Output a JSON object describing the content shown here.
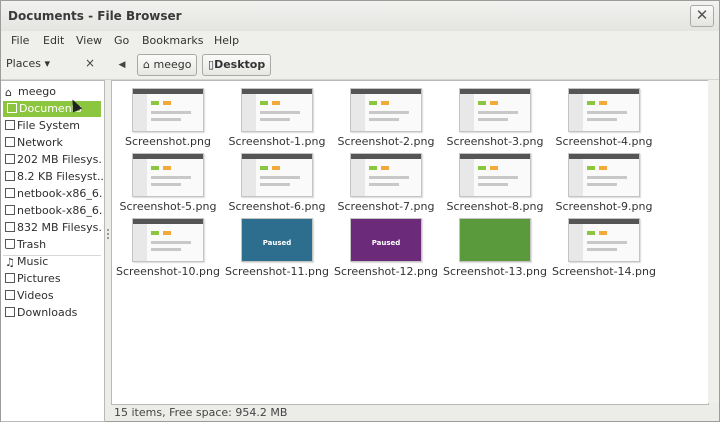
{
  "window": {
    "title": "Documents - File Browser",
    "close_glyph": "✕"
  },
  "menu": [
    "File",
    "Edit",
    "View",
    "Go",
    "Bookmarks",
    "Help"
  ],
  "toolbar": {
    "places_label": "Places ▾",
    "places_close": "×",
    "back_glyph": "◀",
    "crumbs": [
      "meego",
      "Desktop"
    ]
  },
  "sidebar": {
    "items": [
      {
        "label": "meego",
        "icon": "home-icon"
      },
      {
        "label": "Documents",
        "icon": "document-icon",
        "selected": true
      },
      {
        "label": "File System",
        "icon": "drive-icon"
      },
      {
        "label": "Network",
        "icon": "network-icon"
      },
      {
        "label": "202 MB Filesys...",
        "icon": "drive-icon"
      },
      {
        "label": "8.2 KB Filesyst...",
        "icon": "drive-icon"
      },
      {
        "label": "netbook-x86_6...",
        "icon": "drive-icon"
      },
      {
        "label": "netbook-x86_6...",
        "icon": "drive-icon"
      },
      {
        "label": "832 MB Filesys...",
        "icon": "drive-icon"
      },
      {
        "label": "Trash",
        "icon": "trash-icon"
      },
      {
        "label": "Music",
        "icon": "music-icon"
      },
      {
        "label": "Pictures",
        "icon": "pictures-icon"
      },
      {
        "label": "Videos",
        "icon": "videos-icon"
      },
      {
        "label": "Downloads",
        "icon": "downloads-icon"
      }
    ]
  },
  "files": [
    {
      "name": "Screenshot.png",
      "thumb": "ui"
    },
    {
      "name": "Screenshot-1.png",
      "thumb": "ui"
    },
    {
      "name": "Screenshot-2.png",
      "thumb": "ui"
    },
    {
      "name": "Screenshot-3.png",
      "thumb": "ui"
    },
    {
      "name": "Screenshot-4.png",
      "thumb": "ui"
    },
    {
      "name": "Screenshot-5.png",
      "thumb": "ui"
    },
    {
      "name": "Screenshot-6.png",
      "thumb": "ui"
    },
    {
      "name": "Screenshot-7.png",
      "thumb": "ui"
    },
    {
      "name": "Screenshot-8.png",
      "thumb": "ui"
    },
    {
      "name": "Screenshot-9.png",
      "thumb": "ui"
    },
    {
      "name": "Screenshot-10.png",
      "thumb": "ui"
    },
    {
      "name": "Screenshot-11.png",
      "thumb": "game",
      "overlay": "Paused"
    },
    {
      "name": "Screenshot-12.png",
      "thumb": "game2",
      "overlay": "Paused"
    },
    {
      "name": "Screenshot-13.png",
      "thumb": "game3"
    },
    {
      "name": "Screenshot-14.png",
      "thumb": "ui"
    }
  ],
  "status": "15 items, Free space: 954.2 MB",
  "colors": {
    "accent": "#8cc63f"
  }
}
